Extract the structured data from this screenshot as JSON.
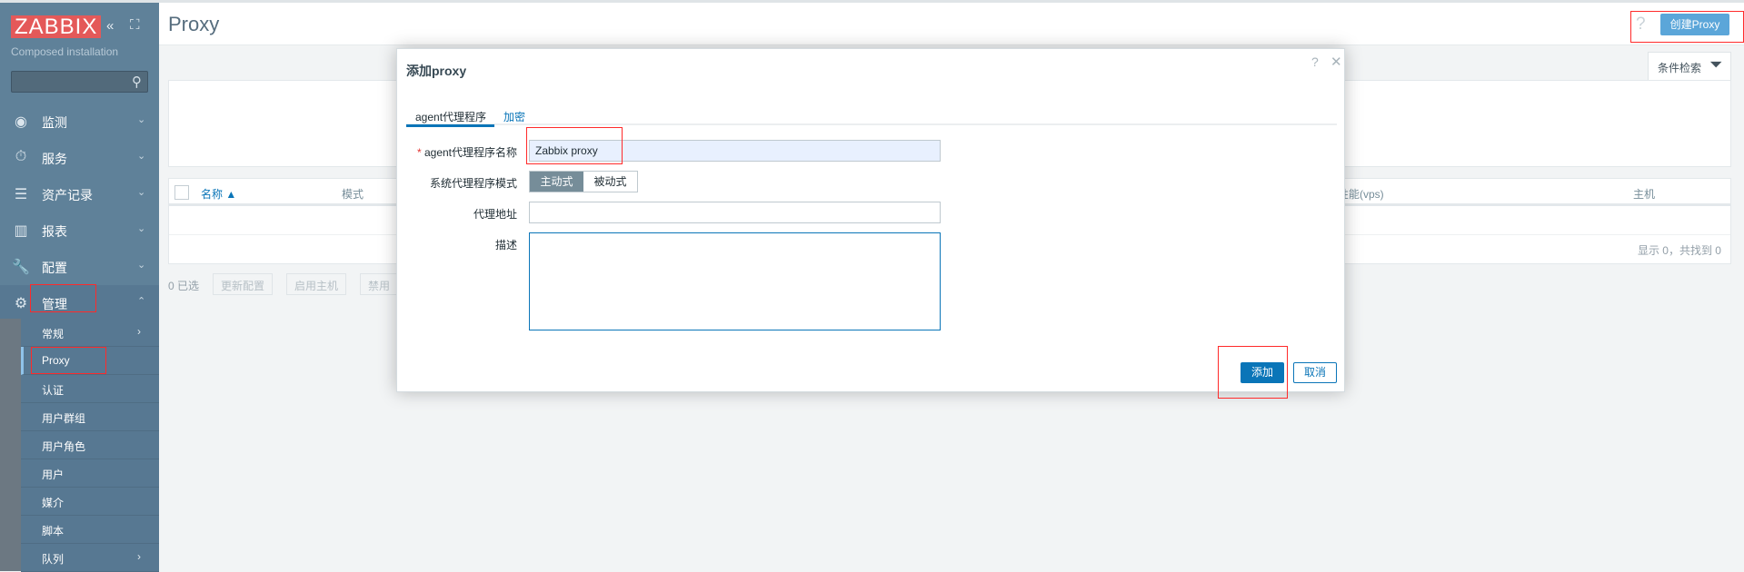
{
  "sidebar": {
    "logo": "ZABBIX",
    "subtitle": "Composed installation",
    "search_placeholder": "",
    "menu": [
      {
        "label": "监测",
        "icon": "eye-icon"
      },
      {
        "label": "服务",
        "icon": "stopwatch-icon"
      },
      {
        "label": "资产记录",
        "icon": "list-icon"
      },
      {
        "label": "报表",
        "icon": "bar-chart-icon"
      },
      {
        "label": "配置",
        "icon": "wrench-icon"
      },
      {
        "label": "管理",
        "icon": "gear-icon"
      }
    ],
    "submenu": [
      {
        "label": "常规",
        "has_arrow": true
      },
      {
        "label": "Proxy",
        "active": true
      },
      {
        "label": "认证"
      },
      {
        "label": "用户群组"
      },
      {
        "label": "用户角色"
      },
      {
        "label": "用户"
      },
      {
        "label": "媒介"
      },
      {
        "label": "脚本"
      },
      {
        "label": "队列",
        "has_arrow": true
      }
    ]
  },
  "header": {
    "title": "Proxy",
    "help": "?",
    "create_button": "创建Proxy"
  },
  "filter": {
    "tab_label": "条件检索"
  },
  "table": {
    "columns": [
      "名称 ▲",
      "模式",
      "求的性能(vps)",
      "主机"
    ],
    "footer": "显示 0，共找到 0"
  },
  "actions": {
    "selected": "0 已选",
    "buttons": [
      "更新配置",
      "启用主机",
      "禁用"
    ]
  },
  "dialog": {
    "title": "添加proxy",
    "help": "?",
    "close": "✕",
    "tabs": [
      "agent代理程序",
      "加密"
    ],
    "fields": {
      "name_label": "agent代理程序名称",
      "name_value": "Zabbix proxy",
      "mode_label": "系统代理程序模式",
      "mode_options": [
        "主动式",
        "被动式"
      ],
      "mode_selected": "主动式",
      "address_label": "代理地址",
      "address_value": "",
      "description_label": "描述",
      "description_value": ""
    },
    "add_button": "添加",
    "cancel_button": "取消"
  },
  "colors": {
    "sidebar": "#5f8199",
    "accent": "#0a75b8",
    "logo": "#e45959",
    "highlight_box": "#ff2a2a"
  }
}
